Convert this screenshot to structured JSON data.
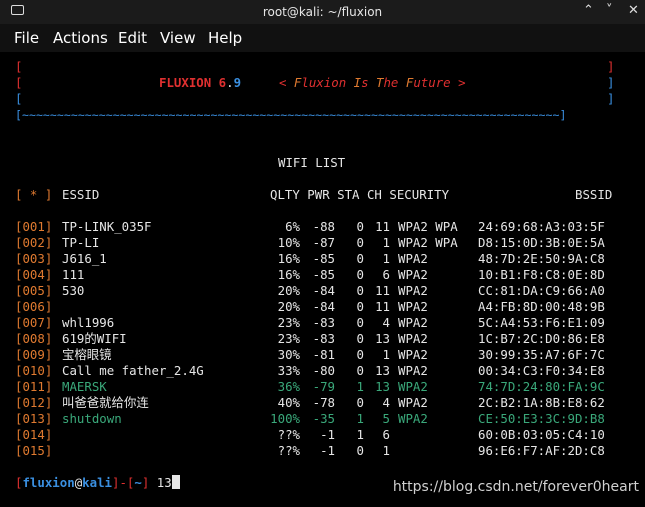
{
  "window": {
    "title": "root@kali: ~/fluxion",
    "minimize": "⌃",
    "maximize": "˅",
    "close": "✕"
  },
  "menu": [
    "File",
    "Actions",
    "Edit",
    "View",
    "Help"
  ],
  "banner": {
    "lb": "[",
    "rb": "]",
    "name": "FLUXION 6",
    "dot": ".",
    "ver": "9",
    "motto_open": "< ",
    "motto_F": "F",
    "motto_a": "luxion ",
    "motto_I": "I",
    "motto_b": "s ",
    "motto_T": "T",
    "motto_c": "he ",
    "motto_F2": "F",
    "motto_d": "uture",
    "motto_close": " >",
    "rule": "[~~~~~~~~~~~~~~~~~~~~~~~~~~~~~~~~~~~~~~~~~~~~~~~~~~~~~~~~~~~~~~~~~~~~~~~~~~~~~]"
  },
  "list_title": "WIFI LIST",
  "header": {
    "star": "[ * ]",
    "essid": "ESSID",
    "cols": "QLTY PWR STA CH SECURITY",
    "bssid": "BSSID"
  },
  "rows": [
    {
      "n": "001",
      "essid": "TP-LINK_035F",
      "q": "6%",
      "pwr": "-88",
      "sta": "0",
      "ch": "11",
      "sec": "WPA2 WPA",
      "bssid": "24:69:68:A3:03:5F"
    },
    {
      "n": "002",
      "essid": "TP-LI",
      "q": "10%",
      "pwr": "-87",
      "sta": "0",
      "ch": "1",
      "sec": "WPA2 WPA",
      "bssid": "D8:15:0D:3B:0E:5A"
    },
    {
      "n": "003",
      "essid": "J616_1",
      "q": "16%",
      "pwr": "-85",
      "sta": "0",
      "ch": "1",
      "sec": "WPA2",
      "bssid": "48:7D:2E:50:9A:C8"
    },
    {
      "n": "004",
      "essid": "111",
      "q": "16%",
      "pwr": "-85",
      "sta": "0",
      "ch": "6",
      "sec": "WPA2",
      "bssid": "10:B1:F8:C8:0E:8D"
    },
    {
      "n": "005",
      "essid": "530",
      "q": "20%",
      "pwr": "-84",
      "sta": "0",
      "ch": "11",
      "sec": "WPA2",
      "bssid": "CC:81:DA:C9:66:A0"
    },
    {
      "n": "006",
      "essid": "",
      "q": "20%",
      "pwr": "-84",
      "sta": "0",
      "ch": "11",
      "sec": "WPA2",
      "bssid": "A4:FB:8D:00:48:9B"
    },
    {
      "n": "007",
      "essid": "whl1996",
      "q": "23%",
      "pwr": "-83",
      "sta": "0",
      "ch": "4",
      "sec": "WPA2",
      "bssid": "5C:A4:53:F6:E1:09"
    },
    {
      "n": "008",
      "essid": "619的WIFI",
      "q": "23%",
      "pwr": "-83",
      "sta": "0",
      "ch": "13",
      "sec": "WPA2",
      "bssid": "1C:B7:2C:D0:86:E8"
    },
    {
      "n": "009",
      "essid": "宝榕眼镜",
      "q": "30%",
      "pwr": "-81",
      "sta": "0",
      "ch": "1",
      "sec": "WPA2",
      "bssid": "30:99:35:A7:6F:7C"
    },
    {
      "n": "010",
      "essid": "Call me father_2.4G",
      "q": "33%",
      "pwr": "-80",
      "sta": "0",
      "ch": "13",
      "sec": "WPA2",
      "bssid": "00:34:C3:F0:34:E8"
    },
    {
      "n": "011",
      "essid": "MAERSK",
      "q": "36%",
      "pwr": "-79",
      "sta": "1",
      "ch": "13",
      "sec": "WPA2",
      "bssid": "74:7D:24:80:FA:9C"
    },
    {
      "n": "012",
      "essid": "叫爸爸就给你连",
      "q": "40%",
      "pwr": "-78",
      "sta": "0",
      "ch": "4",
      "sec": "WPA2",
      "bssid": "2C:B2:1A:8B:E8:62"
    },
    {
      "n": "013",
      "essid": "shutdown",
      "q": "100%",
      "pwr": "-35",
      "sta": "1",
      "ch": "5",
      "sec": "WPA2",
      "bssid": "CE:50:E3:3C:9D:B8"
    },
    {
      "n": "014",
      "essid": "",
      "q": "??%",
      "pwr": "-1",
      "sta": "1",
      "ch": "6",
      "sec": "",
      "bssid": "60:0B:03:05:C4:10"
    },
    {
      "n": "015",
      "essid": "",
      "q": "??%",
      "pwr": "-1",
      "sta": "0",
      "ch": "1",
      "sec": "",
      "bssid": "96:E6:F7:AF:2D:C8"
    }
  ],
  "prompt": {
    "open": "[",
    "user": "fluxion",
    "at": "@",
    "host": "kali",
    "mid": "]-[",
    "path": "~",
    "close": "]",
    "input": "13"
  },
  "watermark": "https://blog.csdn.net/forever0heart",
  "colors": {
    "red": "#e03030",
    "blue": "#3a8fe0",
    "orange": "#e07a30",
    "green": "#3aa87a"
  }
}
